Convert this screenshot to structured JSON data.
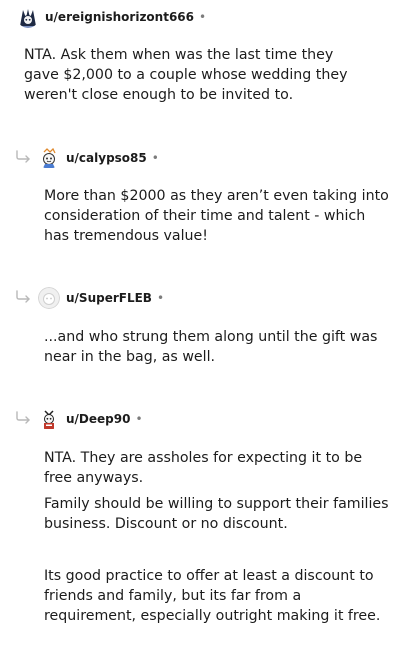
{
  "comments": [
    {
      "username": "u/ereignishorizont666",
      "separator": "•",
      "avatar_icon": "snoo-avatar-icon",
      "paragraphs": [
        "NTA. Ask them when was the last time they gave $2,000 to a couple whose wedding they weren't close enough to be invited to."
      ]
    },
    {
      "username": "u/calypso85",
      "separator": "•",
      "avatar_icon": "snoo-avatar-icon",
      "reply_icon": "reply-arrow-icon",
      "paragraphs": [
        "More than $2000 as they aren’t even taking into consideration of their time and talent - which has tremendous value!"
      ]
    },
    {
      "username": "u/SuperFLEB",
      "separator": "•",
      "avatar_icon": "default-avatar-icon",
      "reply_icon": "reply-arrow-icon",
      "paragraphs": [
        "...and who strung them along until the gift was near in the bag, as well."
      ]
    },
    {
      "username": "u/Deep90",
      "separator": "•",
      "avatar_icon": "snoo-avatar-icon",
      "reply_icon": "reply-arrow-icon",
      "paragraphs": [
        "NTA. They are assholes for expecting it to be free anyways.",
        "Family should be willing to support their families business. Discount or no discount.",
        "Its good practice to offer at least a discount to friends and family, but its far from a requirement, especially outright making it free."
      ]
    }
  ]
}
